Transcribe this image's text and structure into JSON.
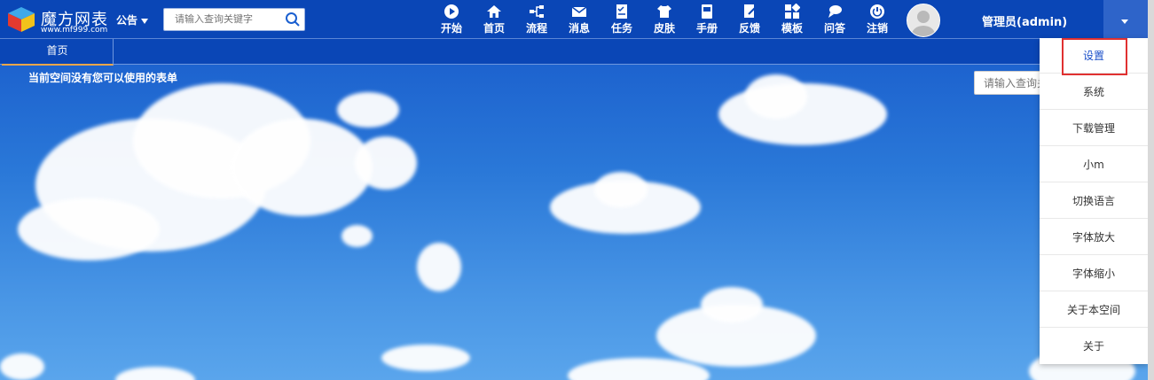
{
  "header": {
    "logo_title": "魔方网表",
    "logo_url": "www.mf999.com",
    "notice_label": "公告",
    "search_placeholder": "请输入查询关键字",
    "nav": [
      {
        "label": "开始",
        "icon": "play-icon"
      },
      {
        "label": "首页",
        "icon": "home-icon"
      },
      {
        "label": "流程",
        "icon": "flow-icon"
      },
      {
        "label": "消息",
        "icon": "mail-icon"
      },
      {
        "label": "任务",
        "icon": "task-icon"
      },
      {
        "label": "皮肤",
        "icon": "shirt-icon"
      },
      {
        "label": "手册",
        "icon": "manual-icon"
      },
      {
        "label": "反馈",
        "icon": "feedback-icon"
      },
      {
        "label": "模板",
        "icon": "grid-icon"
      },
      {
        "label": "问答",
        "icon": "qa-icon"
      },
      {
        "label": "注销",
        "icon": "power-icon"
      }
    ],
    "user_label": "管理员(admin)"
  },
  "tabs": [
    {
      "label": "首页"
    }
  ],
  "main": {
    "empty_message": "当前空间没有您可以使用的表单",
    "search_placeholder": "请输入查询关键字"
  },
  "user_menu": {
    "items": [
      {
        "label": "设置",
        "active": true
      },
      {
        "label": "系统"
      },
      {
        "label": "下载管理"
      },
      {
        "label": "小m"
      },
      {
        "label": "切换语言"
      },
      {
        "label": "字体放大"
      },
      {
        "label": "字体缩小"
      },
      {
        "label": "关于本空间"
      },
      {
        "label": "关于"
      }
    ]
  },
  "colors": {
    "topbar": "#0a46b6",
    "tab_underline": "#f0a64a",
    "menu_active": "#1a4fc9",
    "highlight_border": "#e03131"
  }
}
